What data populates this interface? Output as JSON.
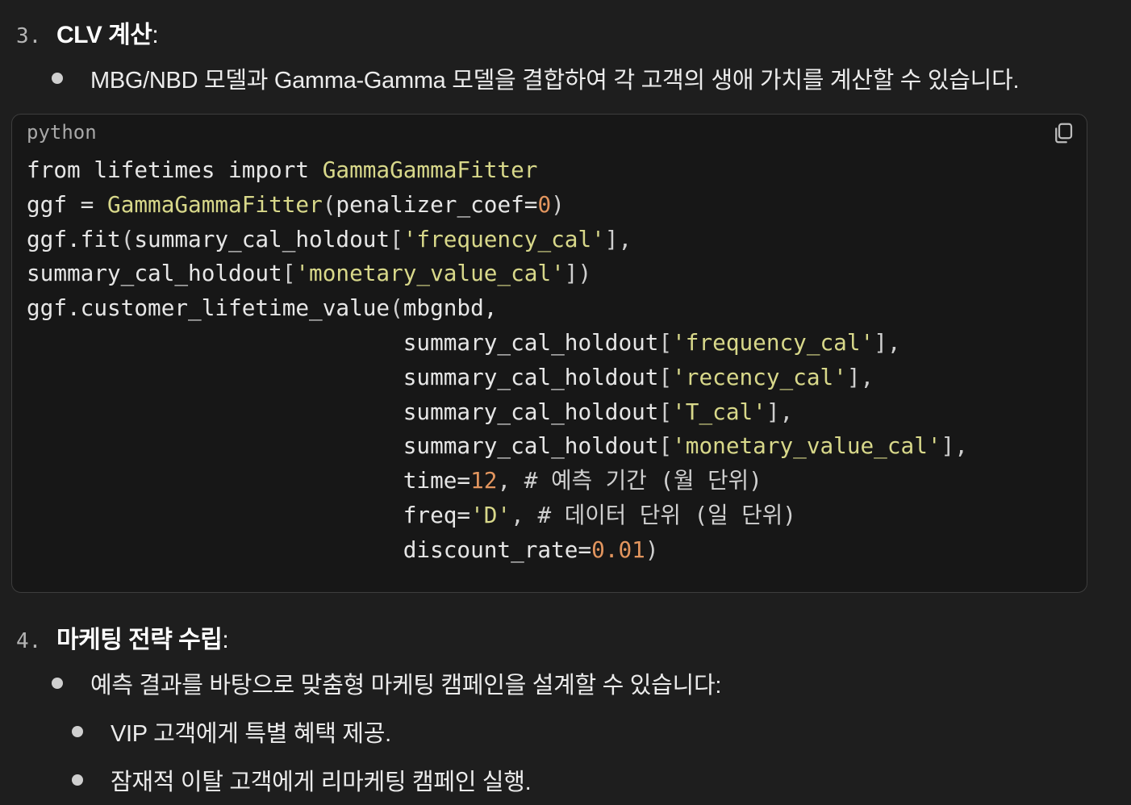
{
  "steps": [
    {
      "number": "3.",
      "title": "CLV 계산",
      "colon": ":"
    },
    {
      "number": "4.",
      "title": "마케팅 전략 수립",
      "colon": ":"
    }
  ],
  "bullets": {
    "clv": "MBG/NBD 모델과 Gamma-Gamma 모델을 결합하여 각 고객의 생애 가치를 계산할 수 있습니다.",
    "marketing": "예측 결과를 바탕으로 맞춤형 마케팅 캠페인을 설계할 수 있습니다:",
    "vip": "VIP 고객에게 특별 혜택 제공.",
    "churn": "잠재적 이탈 고객에게 리마케팅 캠페인 실행."
  },
  "code_block": {
    "language": "python",
    "copy_icon": "copy-icon",
    "lines": [
      [
        [
          "plain",
          "from lifetimes import "
        ],
        [
          "class",
          "GammaGammaFitter"
        ]
      ],
      [
        [
          "plain",
          "ggf = "
        ],
        [
          "class",
          "GammaGammaFitter"
        ],
        [
          "punc",
          "("
        ],
        [
          "plain",
          "penalizer_coef="
        ],
        [
          "num",
          "0"
        ],
        [
          "punc",
          ")"
        ]
      ],
      [
        [
          "plain",
          "ggf.fit"
        ],
        [
          "punc",
          "("
        ],
        [
          "plain",
          "summary_cal_holdout"
        ],
        [
          "punc",
          "["
        ],
        [
          "str",
          "'frequency_cal'"
        ],
        [
          "punc",
          "],"
        ]
      ],
      [
        [
          "plain",
          "summary_cal_holdout"
        ],
        [
          "punc",
          "["
        ],
        [
          "str",
          "'monetary_value_cal'"
        ],
        [
          "punc",
          "])"
        ]
      ],
      [
        [
          "plain",
          "ggf.customer_lifetime_value"
        ],
        [
          "punc",
          "("
        ],
        [
          "plain",
          "mbgnbd,"
        ]
      ],
      [
        [
          "plain",
          "                            summary_cal_holdout"
        ],
        [
          "punc",
          "["
        ],
        [
          "str",
          "'frequency_cal'"
        ],
        [
          "punc",
          "],"
        ]
      ],
      [
        [
          "plain",
          "                            summary_cal_holdout"
        ],
        [
          "punc",
          "["
        ],
        [
          "str",
          "'recency_cal'"
        ],
        [
          "punc",
          "],"
        ]
      ],
      [
        [
          "plain",
          "                            summary_cal_holdout"
        ],
        [
          "punc",
          "["
        ],
        [
          "str",
          "'T_cal'"
        ],
        [
          "punc",
          "],"
        ]
      ],
      [
        [
          "plain",
          "                            summary_cal_holdout"
        ],
        [
          "punc",
          "["
        ],
        [
          "str",
          "'monetary_value_cal'"
        ],
        [
          "punc",
          "],"
        ]
      ],
      [
        [
          "plain",
          "                            time="
        ],
        [
          "num",
          "12"
        ],
        [
          "punc",
          ", "
        ],
        [
          "com",
          "# 예측 기간 (월 단위)"
        ]
      ],
      [
        [
          "plain",
          "                            freq="
        ],
        [
          "str",
          "'D'"
        ],
        [
          "punc",
          ", "
        ],
        [
          "com",
          "# 데이터 단위 (일 단위)"
        ]
      ],
      [
        [
          "plain",
          "                            discount_rate="
        ],
        [
          "num",
          "0.01"
        ],
        [
          "punc",
          ")"
        ]
      ]
    ]
  }
}
